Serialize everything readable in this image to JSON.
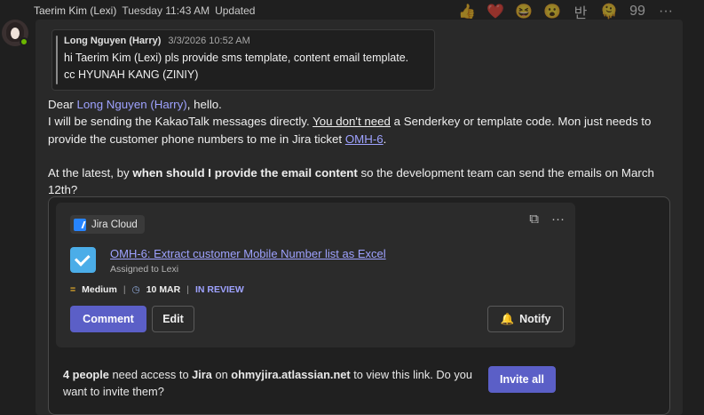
{
  "message": {
    "author": "Taerim Kim (Lexi)",
    "timestamp": "Tuesday 11:43 AM",
    "status": "Updated",
    "reactions": [
      "👍",
      "❤️",
      "😆",
      "😮",
      "반",
      "🫠",
      "99",
      "···"
    ],
    "quote": {
      "author": "Long Nguyen (Harry)",
      "timestamp": "3/3/2026 10:52 AM",
      "line1": "hi Taerim Kim (Lexi) pls provide sms template, content email template.",
      "line2": "cc HYUNAH KANG (ZINIY)"
    },
    "greeting_prefix": "Dear ",
    "greeting_mention": "Long Nguyen (Harry)",
    "greeting_suffix": ", hello.",
    "p1_a": "I will be sending the KakaoTalk messages directly. ",
    "p1_b": "You don't need",
    "p1_c": " a Senderkey or template code. Mon just needs to provide the customer phone numbers to me in Jira ticket ",
    "p1_link": "OMH-6",
    "p1_d": ".",
    "p2_a": "At the latest, by ",
    "p2_b": "when should I provide the email content",
    "p2_c": " so the development team can send the emails on March 12th?"
  },
  "card": {
    "source": "Jira Cloud",
    "issue_title": "OMH-6: Extract customer Mobile Number list as Excel",
    "assigned": "Assigned to Lexi",
    "priority_icon": "=",
    "priority": "Medium",
    "separator": "|",
    "due_icon": "◷",
    "due": "10 MAR",
    "status": "IN REVIEW",
    "comment_label": "Comment",
    "edit_label": "Edit",
    "notify_icon": "🔔",
    "notify_label": "Notify",
    "footer_count": "4 people",
    "footer_a": " need access to ",
    "footer_jira": "Jira",
    "footer_b": " on ",
    "footer_site": "ohmyjira.atlassian.net",
    "footer_c": " to view this link. Do you want to invite them?",
    "invite_label": "Invite all",
    "icons": {
      "copy": "⧉",
      "more": "···"
    }
  }
}
